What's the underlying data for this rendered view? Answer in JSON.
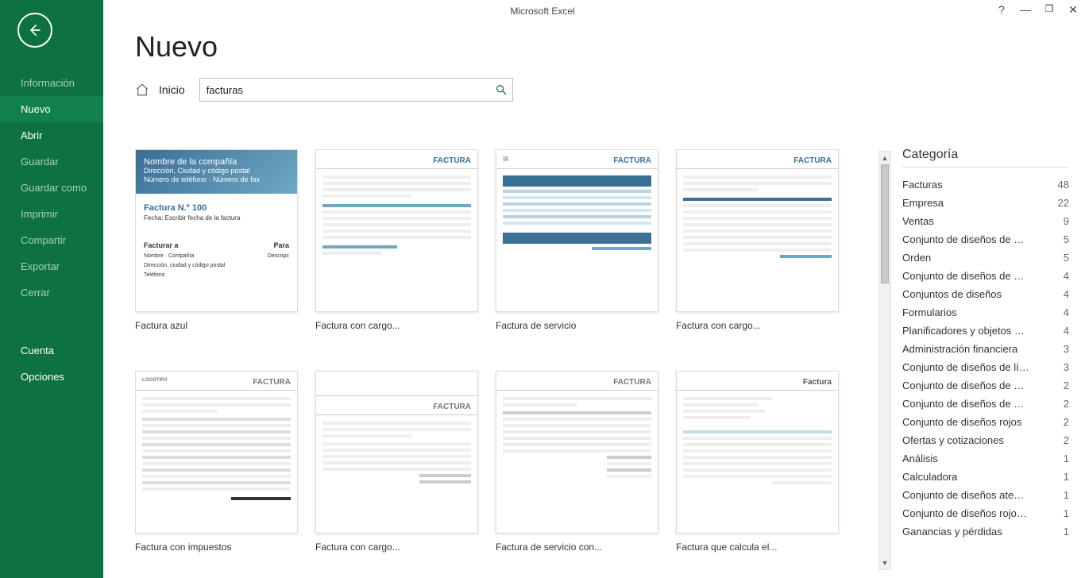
{
  "app_title": "Microsoft Excel",
  "sidebar": {
    "items": [
      {
        "label": "Información",
        "active": false
      },
      {
        "label": "Nuevo",
        "active": true
      },
      {
        "label": "Abrir",
        "active": false
      },
      {
        "label": "Guardar",
        "active": false
      },
      {
        "label": "Guardar como",
        "active": false
      },
      {
        "label": "Imprimir",
        "active": false
      },
      {
        "label": "Compartir",
        "active": false
      },
      {
        "label": "Exportar",
        "active": false
      },
      {
        "label": "Cerrar",
        "active": false
      }
    ],
    "footer": [
      {
        "label": "Cuenta"
      },
      {
        "label": "Opciones"
      }
    ]
  },
  "page_title": "Nuevo",
  "home_label": "Inicio",
  "search": {
    "value": "facturas",
    "placeholder": ""
  },
  "templates": [
    {
      "caption": "Factura azul"
    },
    {
      "caption": "Factura con cargo..."
    },
    {
      "caption": "Factura de servicio"
    },
    {
      "caption": "Factura con cargo..."
    },
    {
      "caption": "Factura con impuestos"
    },
    {
      "caption": "Factura con cargo..."
    },
    {
      "caption": "Factura de servicio con..."
    },
    {
      "caption": "Factura que calcula el..."
    }
  ],
  "category_title": "Categoría",
  "categories": [
    {
      "label": "Facturas",
      "count": "48"
    },
    {
      "label": "Empresa",
      "count": "22"
    },
    {
      "label": "Ventas",
      "count": "9"
    },
    {
      "label": "Conjunto de diseños de deg...",
      "count": "5"
    },
    {
      "label": "Orden",
      "count": "5"
    },
    {
      "label": "Conjunto de diseños de deg...",
      "count": "4"
    },
    {
      "label": "Conjuntos de diseños",
      "count": "4"
    },
    {
      "label": "Formularios",
      "count": "4"
    },
    {
      "label": "Planificadores y objetos de...",
      "count": "4"
    },
    {
      "label": "Administración financiera",
      "count": "3"
    },
    {
      "label": "Conjunto de diseños de líne...",
      "count": "3"
    },
    {
      "label": "Conjunto de diseños de azu...",
      "count": "2"
    },
    {
      "label": "Conjunto de diseños de neg...",
      "count": "2"
    },
    {
      "label": "Conjunto de diseños rojos",
      "count": "2"
    },
    {
      "label": "Ofertas y cotizaciones",
      "count": "2"
    },
    {
      "label": "Análisis",
      "count": "1"
    },
    {
      "label": "Calculadora",
      "count": "1"
    },
    {
      "label": "Conjunto de diseños atemp...",
      "count": "1"
    },
    {
      "label": "Conjunto de diseños rojos y...",
      "count": "1"
    },
    {
      "label": "Ganancias y pérdidas",
      "count": "1"
    }
  ],
  "thumb_blue": {
    "company": "Nombre de la compañía",
    "line1": "Dirección, Ciudad y código postal",
    "line2": "Número de teléfono · Número de fax",
    "invoice": "Factura N.º 100",
    "date": "Fecha: Escribir fecha de la factura",
    "billto": "Facturar a",
    "billto1": "Nombre · Compañía",
    "billto2": "Dirección, ciudad y código postal",
    "billto3": "Teléfono",
    "para": "Para",
    "desc": "Descripc"
  },
  "thumb_word": "FACTURA",
  "thumb_word_alt": "Factura"
}
